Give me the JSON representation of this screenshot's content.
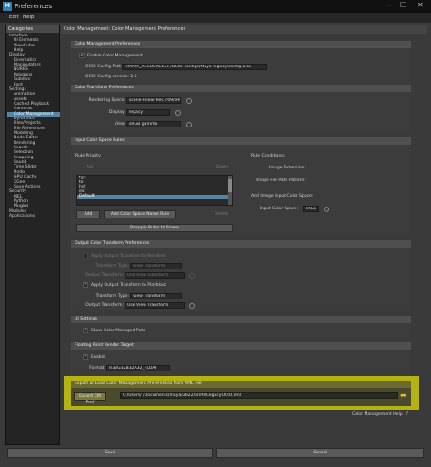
{
  "window": {
    "app_icon": "M",
    "title": "Preferences",
    "controls": [
      "—",
      "☐",
      "✕"
    ]
  },
  "menu": [
    "Edit",
    "Help"
  ],
  "sidebar": {
    "header": "Categories",
    "items": [
      "Interface",
      "UI Elements",
      "ViewCube",
      "Help",
      "Display",
      "Kinematics",
      "Manipulators",
      "NURBS",
      "Polygons",
      "Subdivs",
      "Font",
      "Settings",
      "Animation",
      "Assets",
      "Cached Playback",
      "Cameras",
      "Color Management",
      "Dynamics",
      "Files/Projects",
      "File References",
      "Modeling",
      "Node Editor",
      "Rendering",
      "Search",
      "Selection",
      "Snapping",
      "Sound",
      "Time Slider",
      "Undo",
      "GPU Cache",
      "XGen",
      "Save Actions",
      "Security",
      "MEL",
      "Python",
      "Plugins",
      "Modules",
      "Applications"
    ],
    "selected": "Color Management"
  },
  "main_header": "Color Management: Color Management Preferences",
  "cm_prefs": {
    "title": "Color Management Preferences",
    "enable_label": "Enable Color Management",
    "ocio_path_label": "OCIO Config Path:",
    "ocio_path_value": "<MAYA_RESOURCES>/OCIO-configs/Maya-legacy/config.ocio",
    "ocio_version": "OCIO Config version: 2.0"
  },
  "transform_prefs": {
    "title": "Color Transform Preferences",
    "rendering_space_label": "Rendering Space:",
    "rendering_space_value": "scene-linear Rec 709/sRGB",
    "display_label": "Display:",
    "display_value": "legacy",
    "view_label": "View:",
    "view_value": "sRGB gamma"
  },
  "input_rules": {
    "title": "Input Color Space Rules",
    "rule_priority": "Rule Priority",
    "up": "Up",
    "down": "Down",
    "rules": [
      "tga",
      "tx",
      "hdr",
      "exr",
      "Default"
    ],
    "add": "Add",
    "add_name_rule": "Add Color Space Name Rule",
    "delete": "Delete",
    "reapply": "Reapply Rules to Scene",
    "rule_conditions": "Rule Conditions:",
    "image_extension": "Image Extension:",
    "image_file_path_pattern": "Image File Path Pattern:",
    "add_image_input": "Add Image Input Color Space:",
    "input_color_space_label": "Input Color Space:",
    "input_color_space_value": "sRGB"
  },
  "output_prefs": {
    "title": "Output Color Transform Preferences",
    "apply_renderer": "Apply Output Transform to Renderer",
    "transform_type": "Transform Type:",
    "view_transform": "View Transform",
    "output_transform": "Output Transform:",
    "use_view_transform": "Use View Transform",
    "apply_playblast": "Apply Output Transform to Playblast"
  },
  "ui_settings": {
    "title": "UI Settings",
    "show_managed_pots": "Show Color Managed Pots"
  },
  "fp_target": {
    "title": "Floating Point Render Target",
    "enable": "Enable",
    "format_label": "Format:",
    "format_value": "R32G32B32A32_FLOAT"
  },
  "export": {
    "title": "Export or Load Color Management Preferences from XML File",
    "button": "Export CM Pref",
    "path": "C:/Users/           /Documents/maya/2022/prefs/LegacyOCIO.xml"
  },
  "help_link": "Color Management Help",
  "footer": {
    "save": "Save",
    "cancel": "Cancel"
  },
  "colors": {
    "accent": "#5285a6",
    "highlight": "#c6c40c"
  }
}
